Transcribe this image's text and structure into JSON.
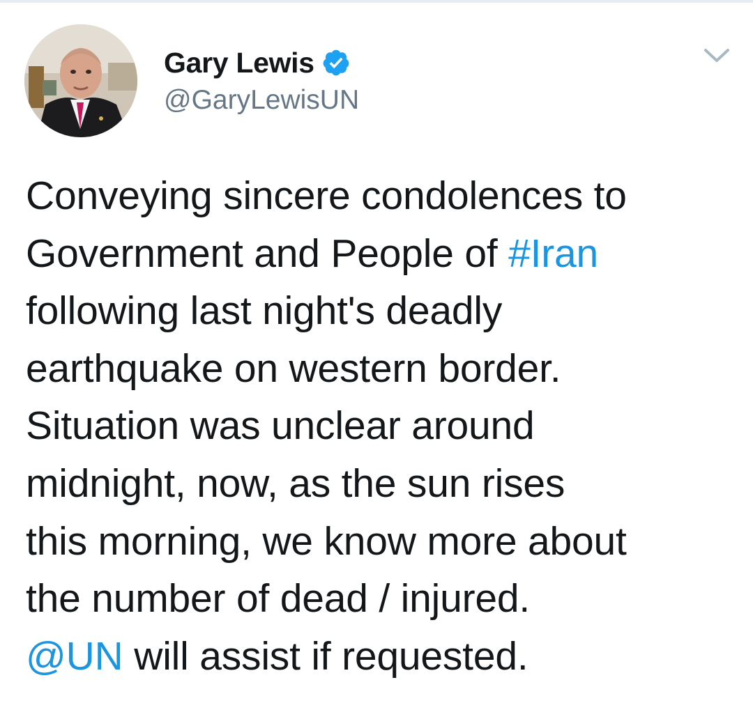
{
  "tweet": {
    "author": {
      "display_name": "Gary Lewis",
      "handle": "@GaryLewisUN",
      "verified": true
    },
    "text_lines": [
      [
        {
          "t": "Conveying sincere condolences to",
          "link": false
        }
      ],
      [
        {
          "t": "Government and People of ",
          "link": false
        },
        {
          "t": "#Iran",
          "link": true
        }
      ],
      [
        {
          "t": "following last night's deadly",
          "link": false
        }
      ],
      [
        {
          "t": "earthquake on western border.",
          "link": false
        }
      ],
      [
        {
          "t": "Situation was unclear around",
          "link": false
        }
      ],
      [
        {
          "t": "midnight, now, as the sun rises",
          "link": false
        }
      ],
      [
        {
          "t": "this morning, we know more about",
          "link": false
        }
      ],
      [
        {
          "t": "the number of dead / injured.",
          "link": false
        }
      ],
      [
        {
          "t": "@UN",
          "link": true
        },
        {
          "t": " will assist if requested.",
          "link": false
        }
      ]
    ]
  },
  "icons": {
    "verified": "verified-badge-icon",
    "more": "chevron-down-icon"
  },
  "colors": {
    "link": "#1b95e0",
    "verified_badge": "#1da1f2",
    "handle": "#657786",
    "text": "#14171a",
    "chevron": "#aab8c2"
  }
}
